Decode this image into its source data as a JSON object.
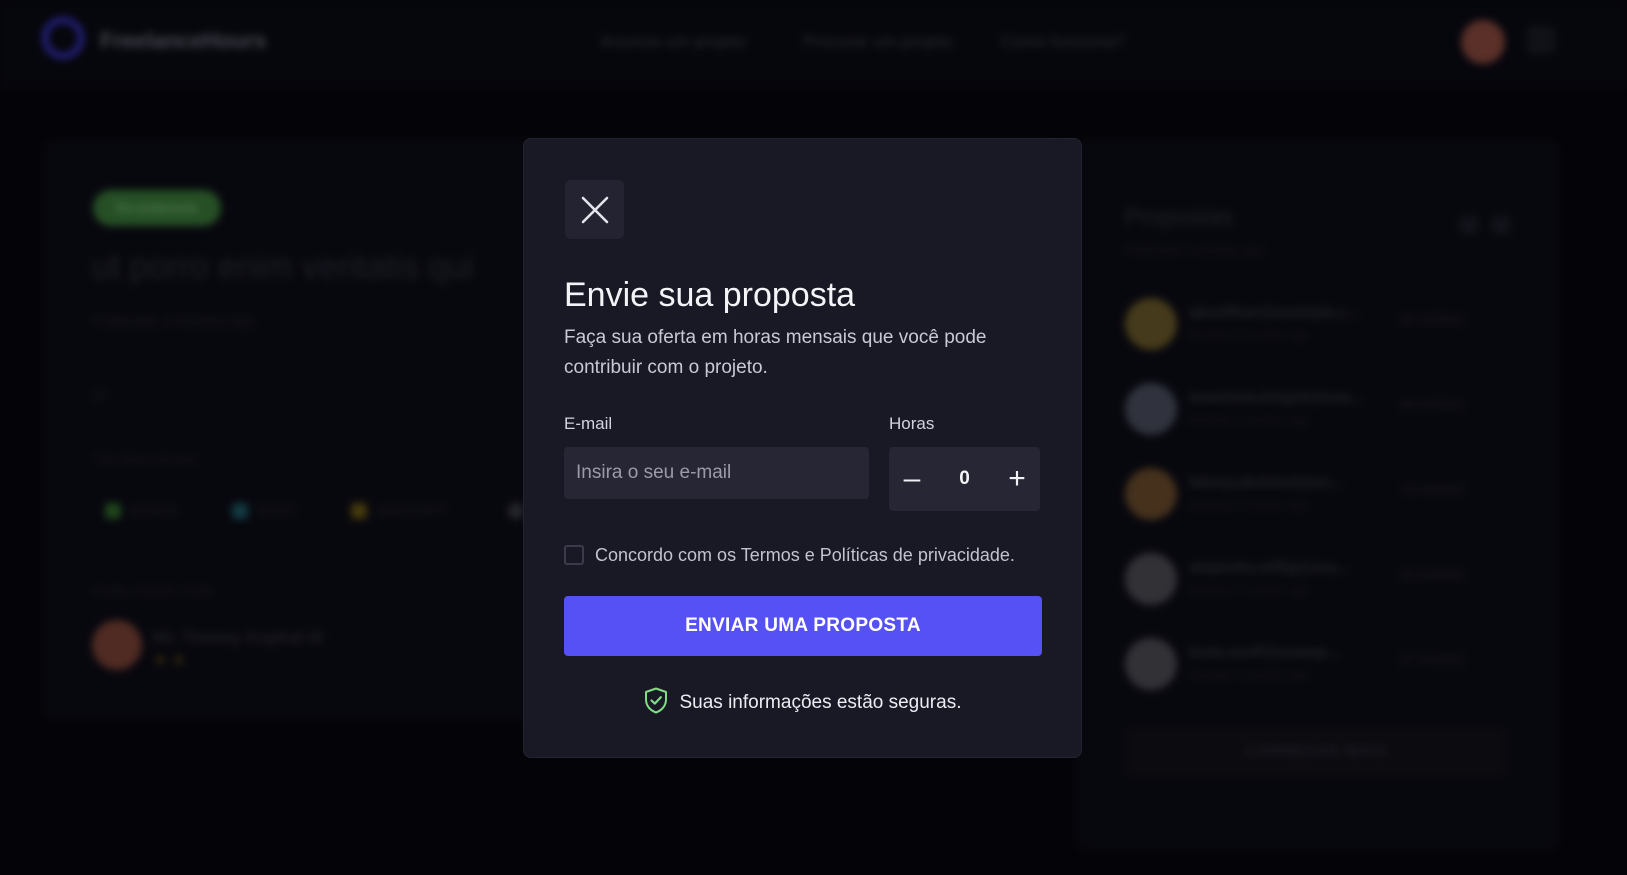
{
  "background": {
    "header": {
      "brand": "FreelanceHours",
      "nav": [
        "Anuncie um projeto",
        "Procurar um projeto",
        "Como funciona?"
      ]
    },
    "project": {
      "status": "Em andamento",
      "title": "ut porro enim veritatis qui",
      "published": "Publicado 3 months ago",
      "id": "ut",
      "technologies_label": "TECNOLOGIAS",
      "technologies": [
        "NODEJS",
        "REACT",
        "JAVASCRIPT"
      ],
      "published_by_label": "PUBLICADO POR",
      "author": "Mr. Tommy Kuphal III",
      "author_stars": "★★"
    },
    "proposals": {
      "title": "Propostas",
      "subtitle": "Publicado 3 months ago",
      "items": [
        {
          "email": "qkoelfleer@example.c...",
          "date": "Enviado 3 months ago",
          "hours": "98 HORAS"
        },
        {
          "email": "anastasia.kingsh@exa...",
          "date": "Enviado 3 months ago",
          "hours": "86 HORAS"
        },
        {
          "email": "fabrey.abshire2@ex...",
          "date": "Enviado 3 months ago",
          "hours": "74 HORAS"
        },
        {
          "email": "alejandra.willig@exa...",
          "date": "Enviado 3 months ago",
          "hours": "30 HORAS"
        },
        {
          "email": "linda.senff@examp...",
          "date": "Enviado 3 months ago",
          "hours": "27 HORAS"
        }
      ],
      "load_more": "CARREGAR MAIS"
    }
  },
  "modal": {
    "title": "Envie sua proposta",
    "description": "Faça sua oferta em horas mensais que você pode contribuir com o projeto.",
    "email_label": "E-mail",
    "email_placeholder": "Insira o seu e-mail",
    "email_value": "",
    "hours_label": "Horas",
    "hours_minus": "–",
    "hours_value": "0",
    "hours_plus": "+",
    "agree_text": "Concordo com os Termos e Políticas de privacidade.",
    "agree_checked": false,
    "submit_label": "ENVIAR UMA PROPOSTA",
    "secure_text": "Suas informações estão seguras.",
    "icons": {
      "close": "close-icon",
      "secure": "shield-check-icon"
    }
  },
  "colors": {
    "page_bg": "#07070d",
    "modal_bg": "#191926",
    "input_bg": "#262634",
    "accent": "#5651f5",
    "secure_icon": "#7fdc84"
  }
}
